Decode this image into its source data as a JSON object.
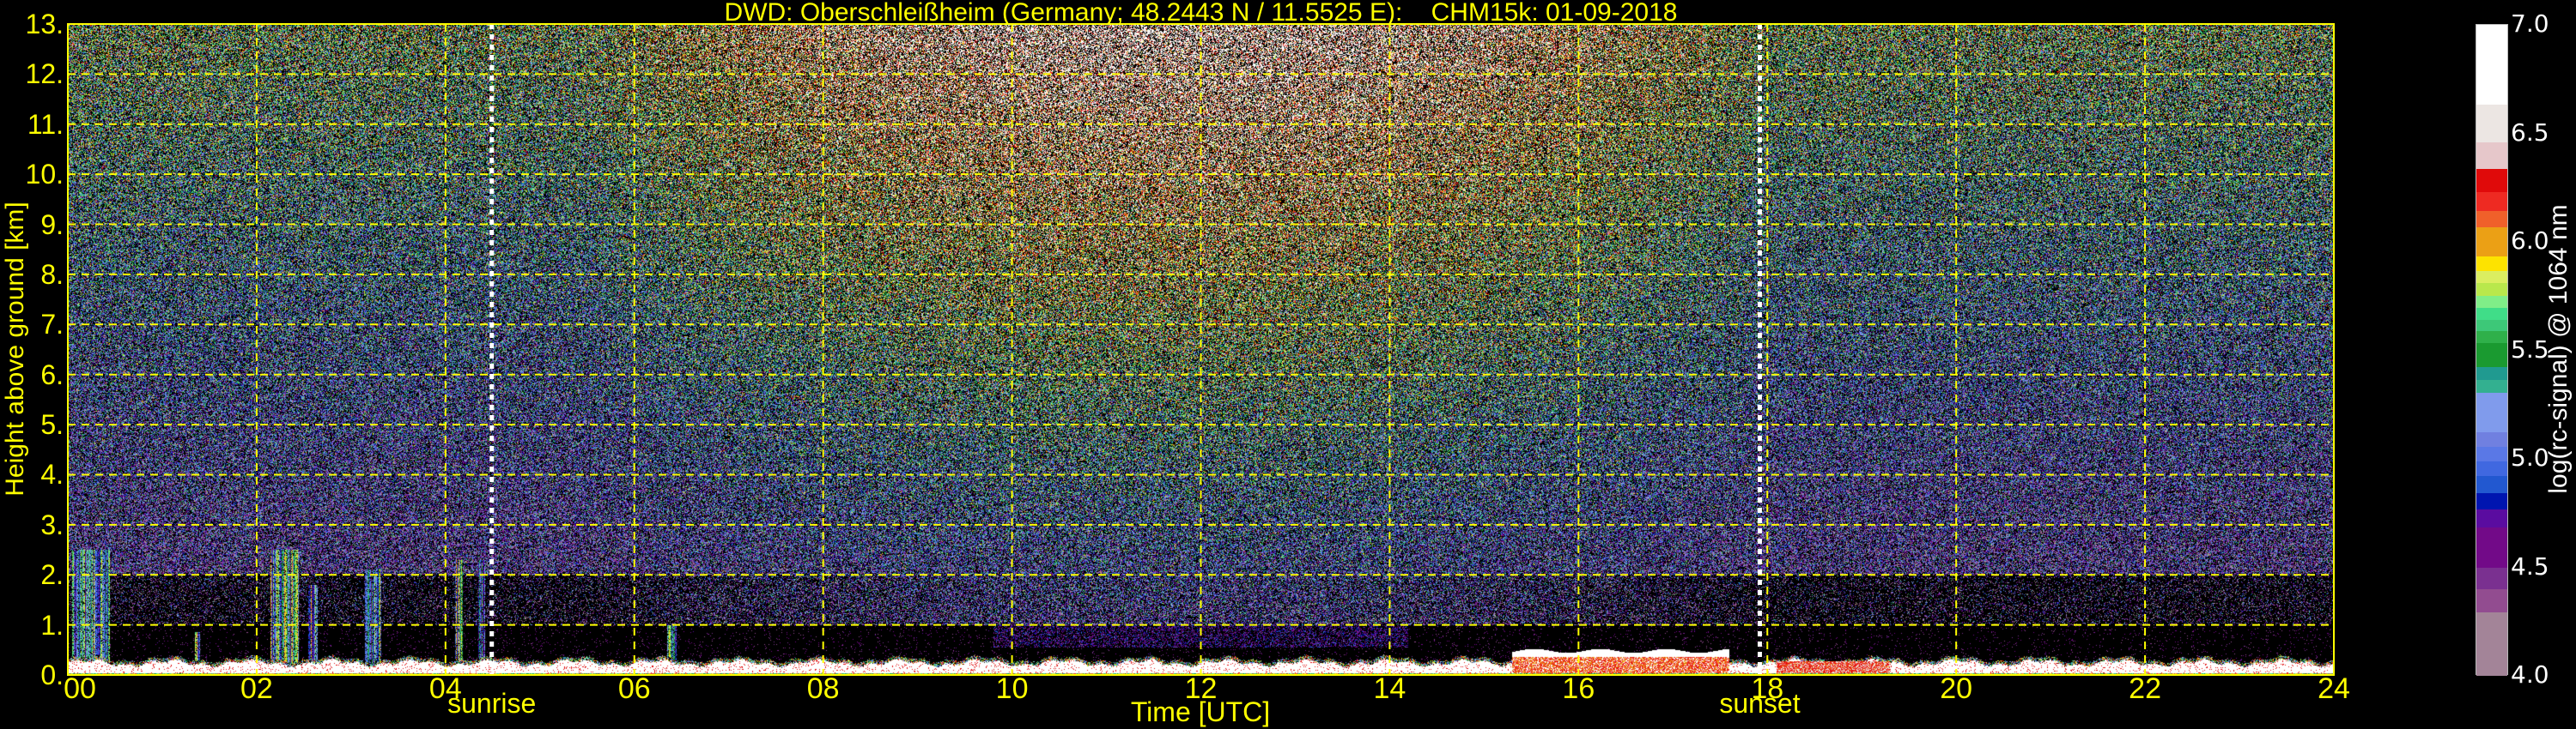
{
  "chart_data": {
    "type": "heatmap",
    "title": "DWD: Oberschleißheim (Germany; 48.2443 N / 11.5525 E):    CHM15k: 01-09-2018",
    "xlabel": "Time [UTC]",
    "ylabel": "Height above ground [km]",
    "xlim": [
      0,
      24
    ],
    "ylim": [
      0,
      13
    ],
    "grid": true,
    "x_ticks": [
      0,
      2,
      4,
      6,
      8,
      10,
      12,
      14,
      16,
      18,
      20,
      22,
      24
    ],
    "x_tick_labels": [
      "00",
      "02",
      "04",
      "06",
      "08",
      "10",
      "12",
      "14",
      "16",
      "18",
      "20",
      "22",
      "24"
    ],
    "y_ticks": [
      0,
      1,
      2,
      3,
      4,
      5,
      6,
      7,
      8,
      9,
      10,
      11,
      12,
      13
    ],
    "y_tick_labels": [
      "0.",
      "1.",
      "2.",
      "3.",
      "4.",
      "5.",
      "6.",
      "7.",
      "8.",
      "9.",
      "10.",
      "11.",
      "12.",
      "13."
    ],
    "annotations": [
      {
        "label": "sunrise",
        "x": 4.49
      },
      {
        "label": "sunset",
        "x": 17.92
      }
    ],
    "colorbar": {
      "label": "log(rc-signal) @ 1064 nm",
      "range": [
        4.0,
        7.0
      ],
      "ticks": [
        4.0,
        4.5,
        5.0,
        5.5,
        6.0,
        6.5,
        7.0
      ],
      "tick_labels": [
        "4.0",
        "4.5",
        "5.0",
        "5.5",
        "6.0",
        "6.5",
        "7.0"
      ],
      "levels": [
        {
          "from": 4.0,
          "to": 4.294,
          "color": "#a38498"
        },
        {
          "from": 4.294,
          "to": 4.403,
          "color": "#924c90"
        },
        {
          "from": 4.403,
          "to": 4.501,
          "color": "#7a3090"
        },
        {
          "from": 4.501,
          "to": 4.684,
          "color": "#720a88"
        },
        {
          "from": 4.684,
          "to": 4.767,
          "color": "#5a0ca0"
        },
        {
          "from": 4.767,
          "to": 4.844,
          "color": "#0015b0"
        },
        {
          "from": 4.844,
          "to": 4.921,
          "color": "#2258d0"
        },
        {
          "from": 4.921,
          "to": 4.99,
          "color": "#4068e0"
        },
        {
          "from": 4.99,
          "to": 5.059,
          "color": "#5a78e6"
        },
        {
          "from": 5.059,
          "to": 5.123,
          "color": "#7080e0"
        },
        {
          "from": 5.123,
          "to": 5.305,
          "color": "#809bec"
        },
        {
          "from": 5.305,
          "to": 5.365,
          "color": "#33b090"
        },
        {
          "from": 5.365,
          "to": 5.423,
          "color": "#209a90"
        },
        {
          "from": 5.423,
          "to": 5.534,
          "color": "#1a9a30"
        },
        {
          "from": 5.534,
          "to": 5.59,
          "color": "#2fb04a"
        },
        {
          "from": 5.59,
          "to": 5.644,
          "color": "#3dc878"
        },
        {
          "from": 5.644,
          "to": 5.699,
          "color": "#40dd88"
        },
        {
          "from": 5.699,
          "to": 5.751,
          "color": "#80ee88"
        },
        {
          "from": 5.751,
          "to": 5.811,
          "color": "#b9e84c"
        },
        {
          "from": 5.811,
          "to": 5.869,
          "color": "#dbee60"
        },
        {
          "from": 5.869,
          "to": 5.933,
          "color": "#fde300"
        },
        {
          "from": 5.933,
          "to": 6.068,
          "color": "#eba015"
        },
        {
          "from": 6.068,
          "to": 6.143,
          "color": "#f0602a"
        },
        {
          "from": 6.143,
          "to": 6.233,
          "color": "#ee2a22"
        },
        {
          "from": 6.233,
          "to": 6.336,
          "color": "#e00a0a"
        },
        {
          "from": 6.336,
          "to": 6.462,
          "color": "#e6c7ca"
        },
        {
          "from": 6.462,
          "to": 6.636,
          "color": "#ece6e3"
        },
        {
          "from": 6.636,
          "to": 7.0,
          "color": "#ffffff"
        }
      ]
    },
    "colors": {
      "axis_text": "#ffff00",
      "grid": "#ffff00",
      "colorbar_text": "#ffffff",
      "background": "#000000"
    }
  }
}
